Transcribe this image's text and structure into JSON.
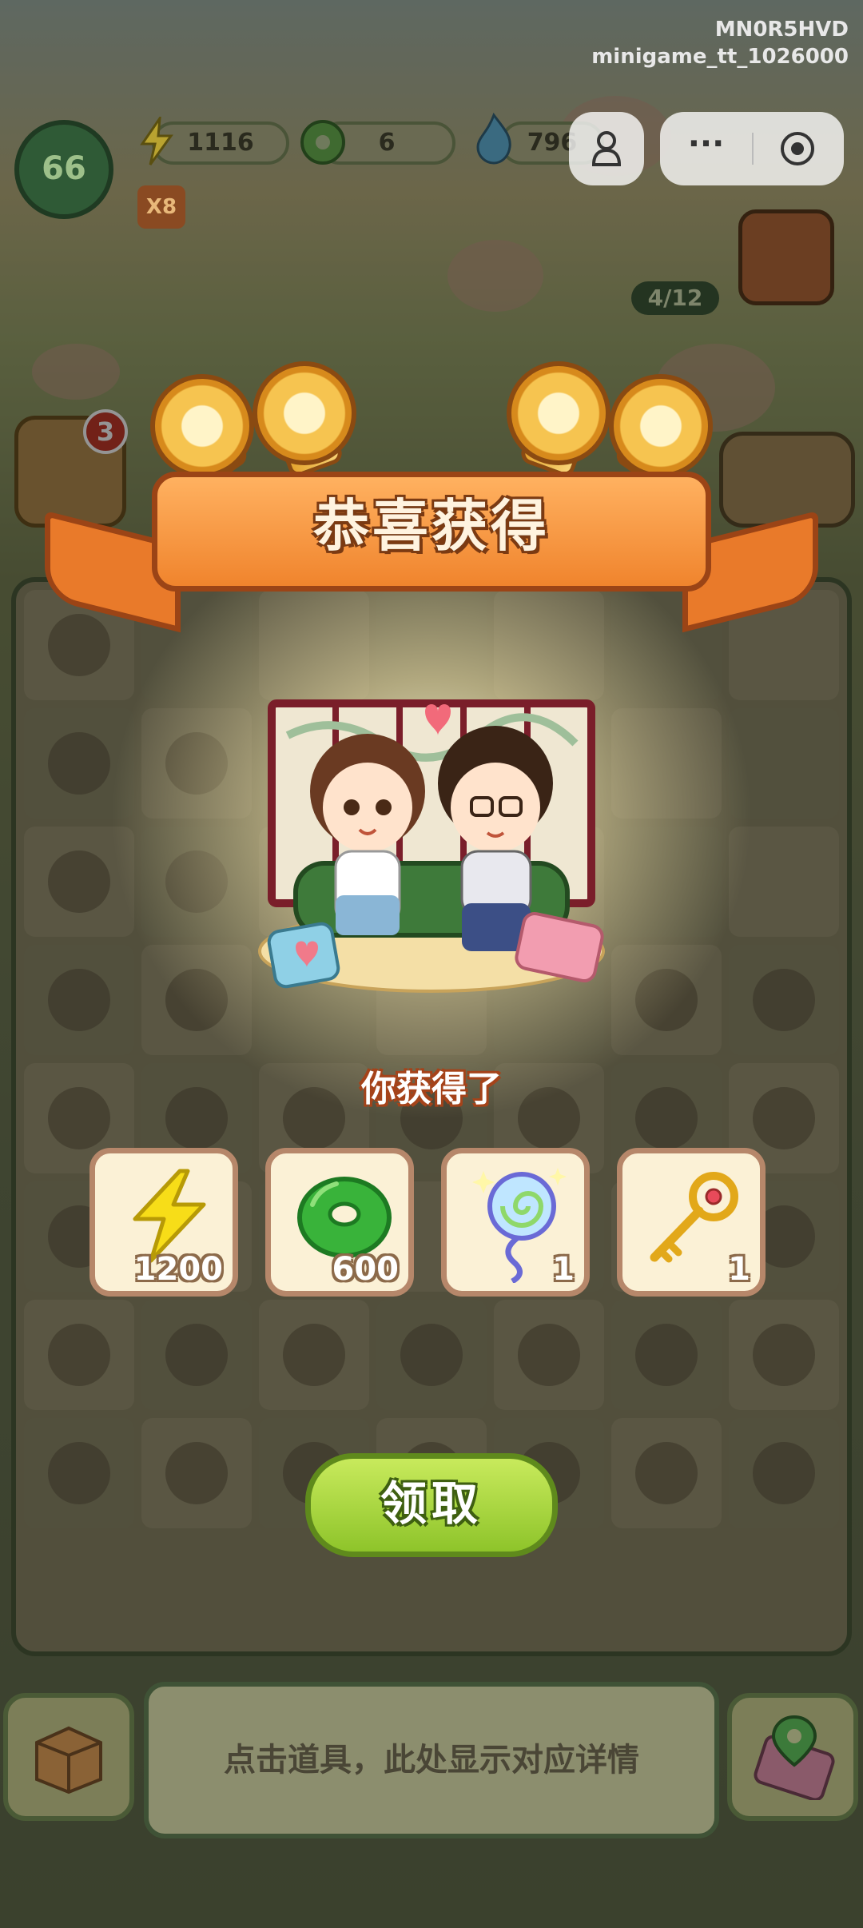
{
  "watermark": {
    "line1": "MN0R5HVD",
    "line2": "minigame_tt_1026000"
  },
  "hud": {
    "level": "66",
    "multiplier": "X8",
    "energy": "1116",
    "jade": "6",
    "flame": "796"
  },
  "scene": {
    "quest_progress": "4/12",
    "badge_count": "3"
  },
  "dialog": {
    "title": "恭喜获得",
    "subtitle": "你获得了",
    "rewards": [
      {
        "icon": "lightning-icon",
        "qty": "1200"
      },
      {
        "icon": "jade-coin-icon",
        "qty": "600"
      },
      {
        "icon": "magic-lollipop-icon",
        "qty": "1"
      },
      {
        "icon": "golden-key-icon",
        "qty": "1"
      }
    ],
    "claim_label": "领取"
  },
  "detail_hint": "点击道具，此处显示对应详情"
}
